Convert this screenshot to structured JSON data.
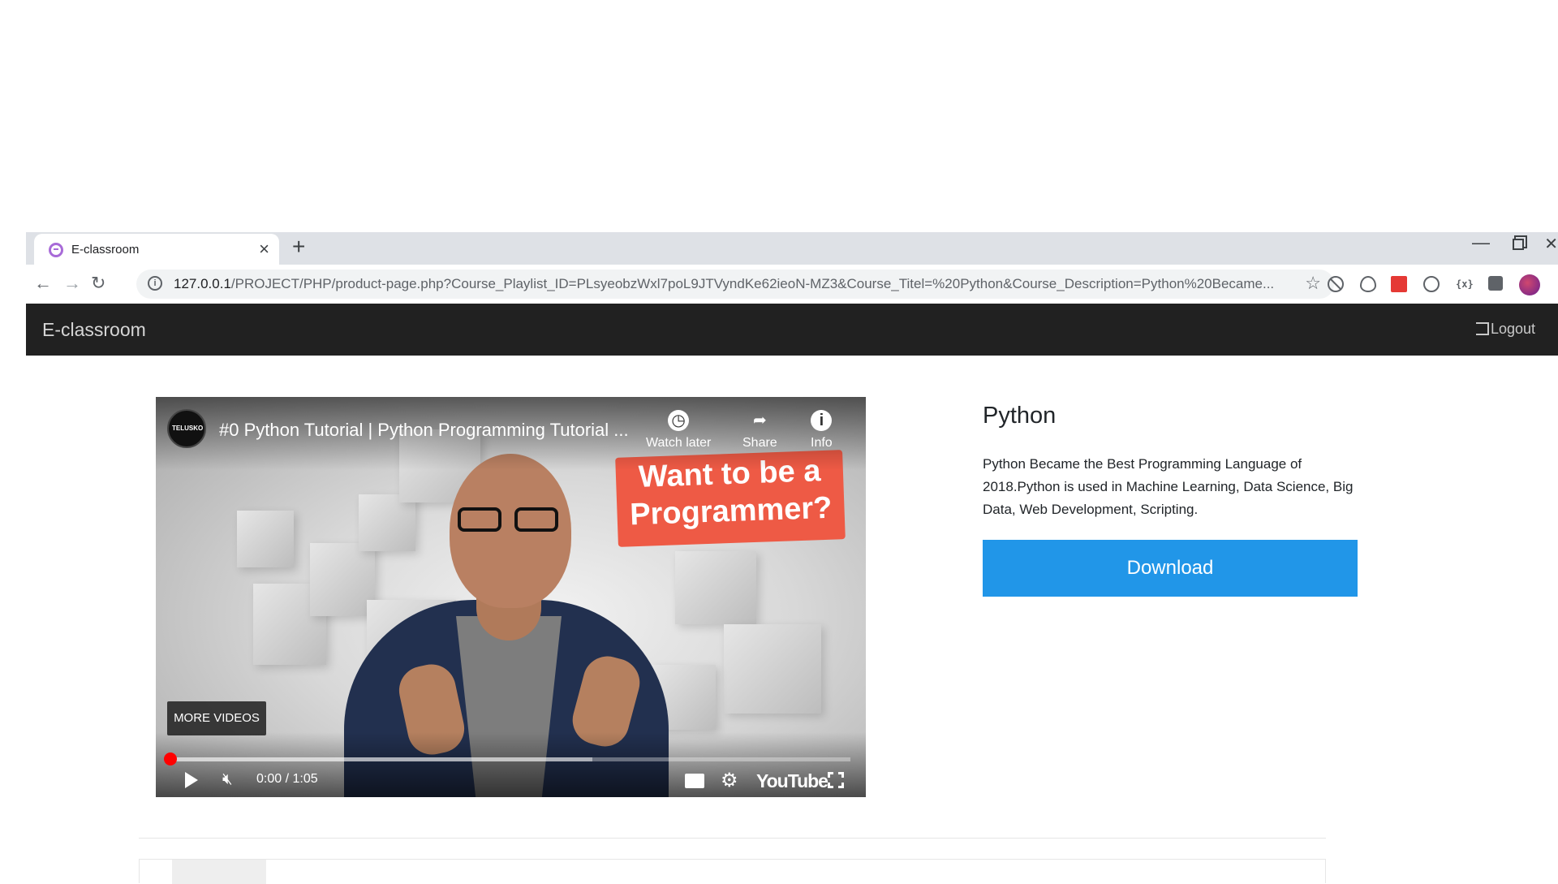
{
  "browser": {
    "tab_title": "E-classroom",
    "tab_close": "×",
    "new_tab": "+",
    "url_host": "127.0.0.1",
    "url_path": "/PROJECT/PHP/product-page.php?Course_Playlist_ID=PLsyeobzWxl7poL9JTVyndKe62ieoN-MZ3&Course_Titel=%20Python&Course_Description=Python%20Became...",
    "icons": [
      "back-icon",
      "forward-icon",
      "reload-icon",
      "info-icon",
      "star-icon",
      "puzzle-icon"
    ]
  },
  "navbar": {
    "brand": "E-classroom",
    "logout": "Logout"
  },
  "video": {
    "channel": "TELUSKO",
    "title": "#0 Python Tutorial | Python Programming Tutorial ...",
    "watch_later": "Watch later",
    "share": "Share",
    "info": "Info",
    "overlay_text_line1": "Want to be a",
    "overlay_text_line2": "Programmer?",
    "more_videos": "MORE VIDEOS",
    "time": "0:00 / 1:05",
    "brand_logo": "YouTube",
    "progress_played": 0,
    "progress_buffered": 0.62
  },
  "course": {
    "title": "Python",
    "description": "Python Became the Best Programming Language of 2018.Python is used in Machine Learning, Data Science, Big Data, Web Development, Scripting.",
    "download_label": "Download",
    "accent_color": "#2196e8"
  }
}
